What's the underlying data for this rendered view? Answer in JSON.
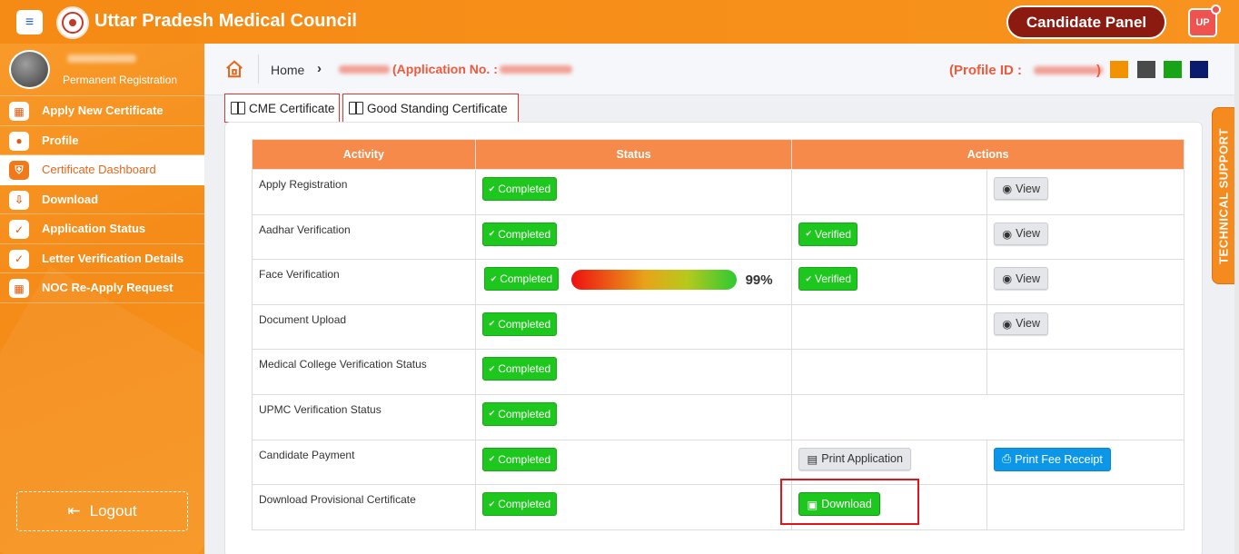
{
  "header": {
    "app_title": "Uttar Pradesh Medical Council",
    "panel_label": "Candidate Panel",
    "user_badge": "UP"
  },
  "sidebar": {
    "profile_subtitle": "Permanent Registration",
    "items": [
      {
        "label": "Apply New Certificate",
        "icon": "grid-icon",
        "active": false
      },
      {
        "label": "Profile",
        "icon": "user-icon",
        "active": false
      },
      {
        "label": "Certificate Dashboard",
        "icon": "shield-icon",
        "active": true
      },
      {
        "label": "Download",
        "icon": "download-icon",
        "active": false
      },
      {
        "label": "Application Status",
        "icon": "check-circle-icon",
        "active": false
      },
      {
        "label": "Letter Verification Details",
        "icon": "check-circle-icon",
        "active": false
      },
      {
        "label": "NOC Re-Apply Request",
        "icon": "grid-icon",
        "active": false
      }
    ],
    "logout_label": "Logout"
  },
  "breadcrumb": {
    "home": "Home",
    "application_label": "(Application No. :",
    "profile_label": "(Profile ID :",
    "profile_close": ")",
    "swatches": [
      "#f39200",
      "#4a4a4a",
      "#17a517",
      "#0a1b6e"
    ]
  },
  "tabs": {
    "cme": "CME Certificate",
    "good_standing": "Good Standing Certificate"
  },
  "tech_support": "TECHNICAL SUPPORT",
  "table": {
    "headers": [
      "Activity",
      "Status",
      "Actions"
    ],
    "completed": "Completed",
    "verified": "Verified",
    "view": "View",
    "print_application": "Print Application",
    "print_fee_receipt": "Print Fee Receipt",
    "download": "Download",
    "face_progress": "99%",
    "rows": [
      "Apply Registration",
      "Aadhar Verification",
      "Face Verification",
      "Document Upload",
      "Medical College Verification Status",
      "UPMC Verification Status",
      "Candidate Payment",
      "Download Provisional Certificate"
    ]
  }
}
